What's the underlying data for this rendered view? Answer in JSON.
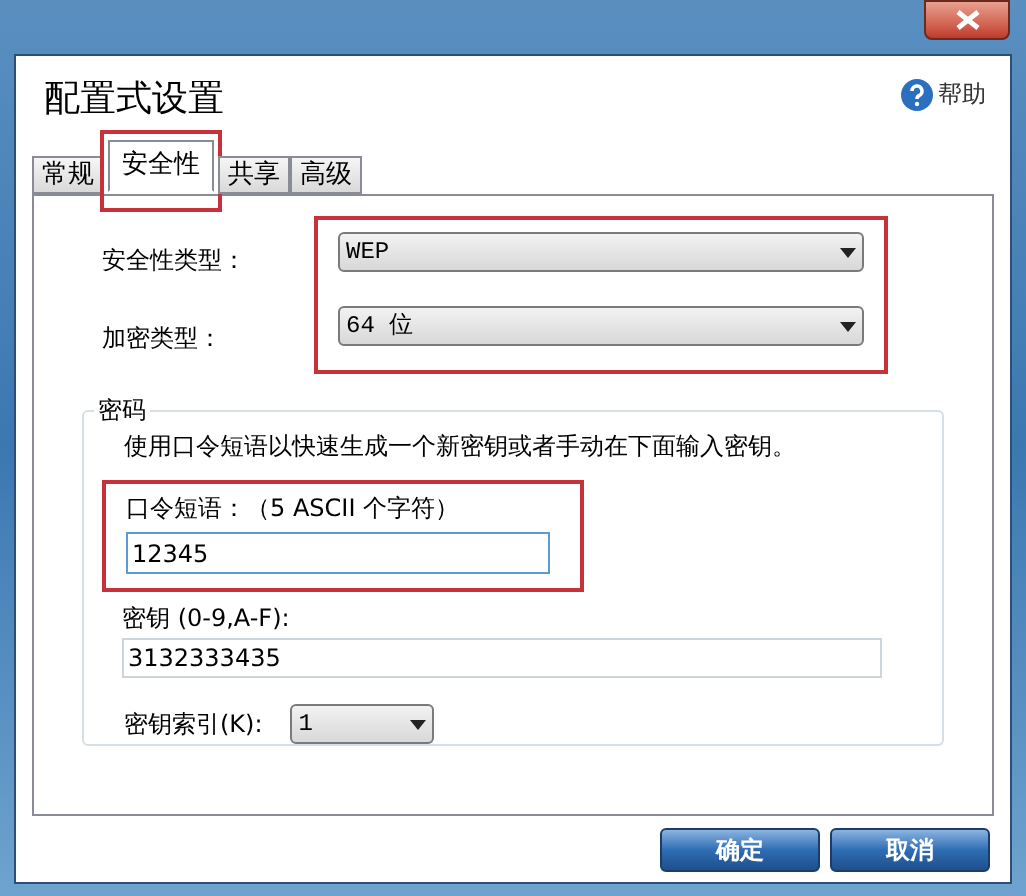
{
  "window": {
    "title": "配置式设置",
    "help": "帮助"
  },
  "tabs": [
    {
      "label": "常规",
      "selected": false,
      "highlighted": false
    },
    {
      "label": "安全性",
      "selected": true,
      "highlighted": true
    },
    {
      "label": "共享",
      "selected": false,
      "highlighted": false
    },
    {
      "label": "高级",
      "selected": false,
      "highlighted": false
    }
  ],
  "security": {
    "highlighted": true,
    "fields": [
      {
        "label": "安全性类型：",
        "value": "WEP"
      },
      {
        "label": "加密类型：",
        "value": "64 位"
      }
    ]
  },
  "password_group": {
    "legend": "密码",
    "description": "使用口令短语以快速生成一个新密钥或者手动在下面输入密钥。",
    "passphrase": {
      "label": "口令短语：（5 ASCII 个字符）",
      "value": "12345",
      "highlighted": true
    },
    "key": {
      "label": "密钥 (0-9,A-F):",
      "value": "3132333435"
    },
    "key_index": {
      "label": "密钥索引(K):",
      "value": "1"
    }
  },
  "buttons": [
    "确定",
    "取消"
  ]
}
